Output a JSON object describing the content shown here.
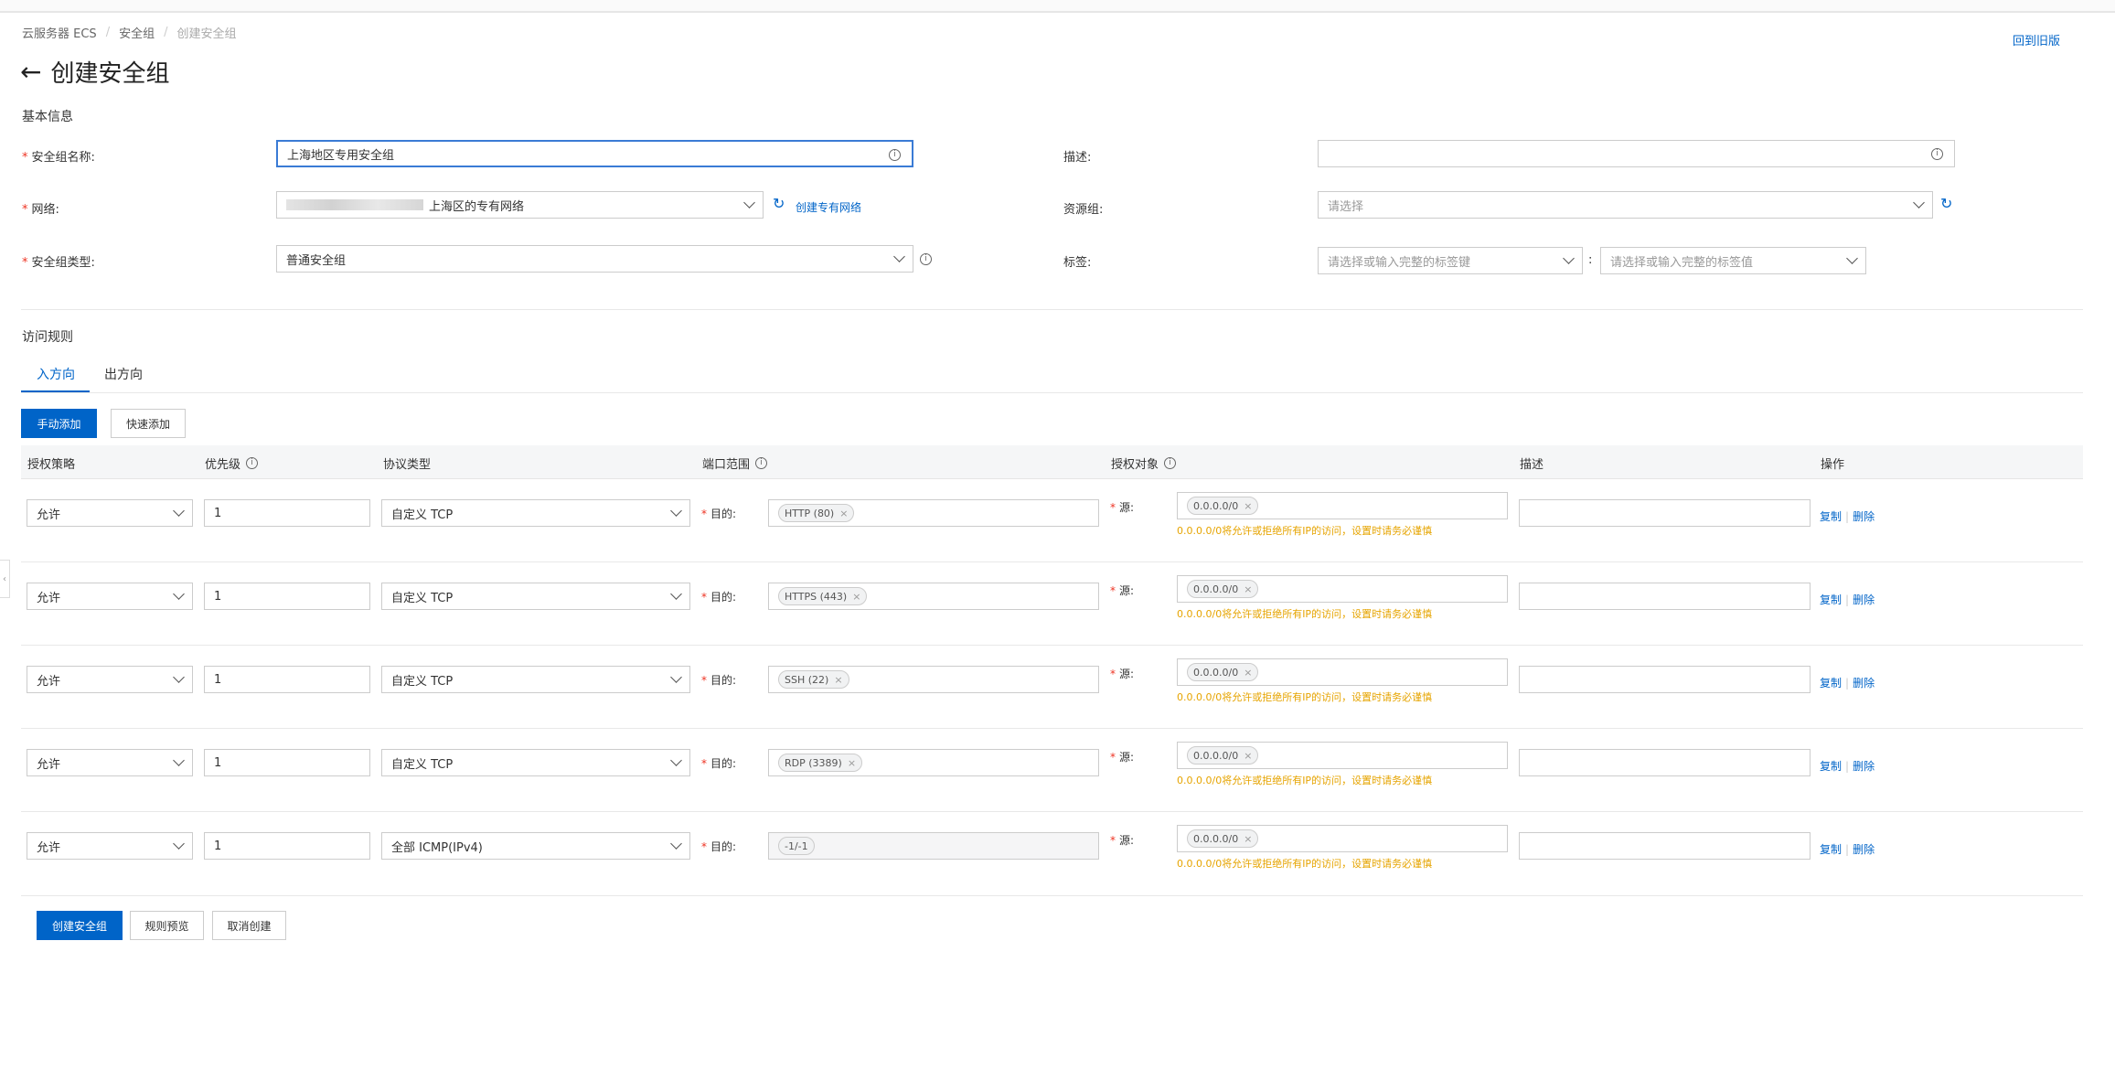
{
  "breadcrumb": [
    "云服务器 ECS",
    "安全组",
    "创建安全组"
  ],
  "back_old_version": "回到旧版",
  "page_title": "创建安全组",
  "basic": {
    "section_title": "基本信息",
    "name_label": "安全组名称:",
    "name_value": "上海地区专用安全组",
    "network_label": "网络:",
    "network_value": "上海区的专有网络",
    "create_vpc_link": "创建专有网络",
    "type_label": "安全组类型:",
    "type_value": "普通安全组",
    "desc_label": "描述:",
    "desc_value": "",
    "resource_group_label": "资源组:",
    "resource_group_placeholder": "请选择",
    "tag_label": "标签:",
    "tag_key_placeholder": "请选择或输入完整的标签键",
    "tag_value_placeholder": "请选择或输入完整的标签值",
    "colon": ":"
  },
  "rules": {
    "section_title": "访问规则",
    "tabs": [
      "入方向",
      "出方向"
    ],
    "add_manual": "手动添加",
    "add_quick": "快速添加",
    "headers": [
      "授权策略",
      "优先级",
      "协议类型",
      "端口范围",
      "授权对象",
      "描述",
      "操作"
    ],
    "dest_label": "目的:",
    "src_label": "源:",
    "warning": "0.0.0.0/0将允许或拒绝所有IP的访问，设置时请务必谨慎",
    "copy": "复制",
    "delete": "删除",
    "rows": [
      {
        "policy": "允许",
        "priority": "1",
        "protocol": "自定义 TCP",
        "port": "HTTP (80)",
        "source": "0.0.0.0/0"
      },
      {
        "policy": "允许",
        "priority": "1",
        "protocol": "自定义 TCP",
        "port": "HTTPS (443)",
        "source": "0.0.0.0/0"
      },
      {
        "policy": "允许",
        "priority": "1",
        "protocol": "自定义 TCP",
        "port": "SSH (22)",
        "source": "0.0.0.0/0"
      },
      {
        "policy": "允许",
        "priority": "1",
        "protocol": "自定义 TCP",
        "port": "RDP (3389)",
        "source": "0.0.0.0/0"
      },
      {
        "policy": "允许",
        "priority": "1",
        "protocol": "全部 ICMP(IPv4)",
        "port": "-1/-1",
        "source": "0.0.0.0/0"
      }
    ]
  },
  "footer": {
    "create": "创建安全组",
    "preview": "规则预览",
    "cancel": "取消创建"
  }
}
